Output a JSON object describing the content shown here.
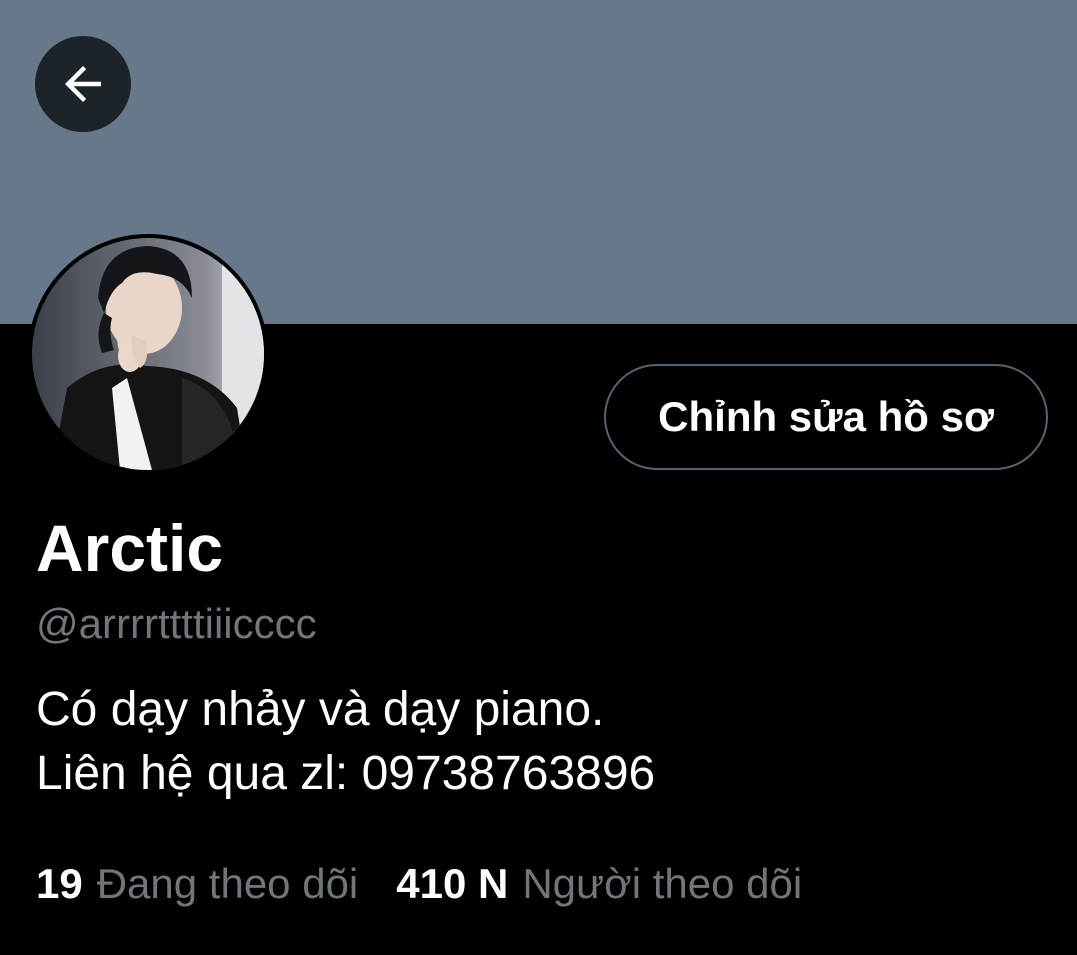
{
  "header": {
    "back_icon": "arrow-left-icon",
    "banner_color": "#66788a"
  },
  "profile": {
    "edit_button_label": "Chỉnh sửa hồ sơ",
    "display_name": "Arctic",
    "handle": "@arrrrttttiiicccc",
    "bio_lines": [
      "Có dạy nhảy và dạy piano.",
      "Liên hệ qua zl: 09738763896"
    ]
  },
  "stats": {
    "following": {
      "count": "19",
      "label": "Đang theo dõi"
    },
    "followers": {
      "count": "410 N",
      "label": "Người theo dõi"
    }
  },
  "colors": {
    "background": "#000000",
    "text_primary": "#ffffff",
    "text_secondary": "#71767b",
    "button_border": "#536471"
  }
}
